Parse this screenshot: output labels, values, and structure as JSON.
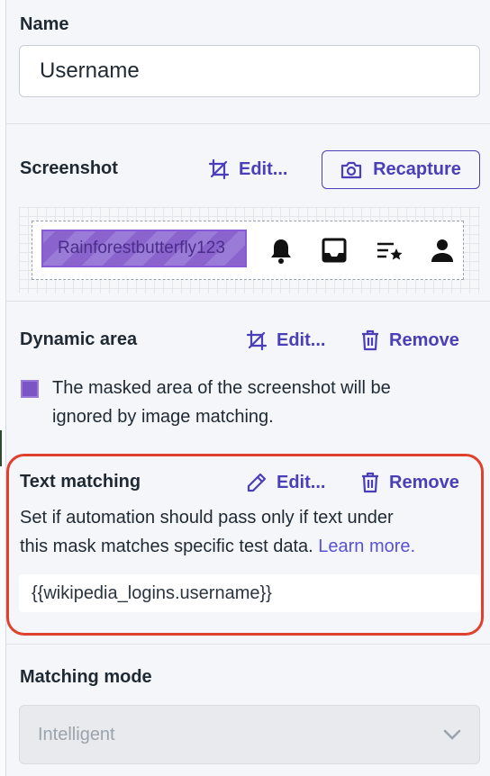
{
  "name": {
    "label": "Name",
    "value": "Username"
  },
  "screenshot": {
    "label": "Screenshot",
    "edit_label": "Edit...",
    "recapture_label": "Recapture",
    "masked_text": "Rainforestbutterfly123",
    "icons": [
      "bell-icon",
      "inbox-icon",
      "list-star-icon",
      "user-icon"
    ]
  },
  "dynamic_area": {
    "label": "Dynamic area",
    "edit_label": "Edit...",
    "remove_label": "Remove",
    "description_line1": "The masked area of the screenshot will be",
    "description_line2": "ignored by image matching."
  },
  "text_matching": {
    "label": "Text matching",
    "edit_label": "Edit...",
    "remove_label": "Remove",
    "description_line1": "Set if automation should pass only if text under",
    "description_line2": "this mask matches specific test data.",
    "learn_more": "Learn more.",
    "value": "{{wikipedia_logins.username}}"
  },
  "matching_mode": {
    "label": "Matching mode",
    "selected": "Intelligent"
  },
  "colors": {
    "accent": "#4a3fb8",
    "highlight_border": "#e0412e",
    "mask": "#8a64cc"
  }
}
